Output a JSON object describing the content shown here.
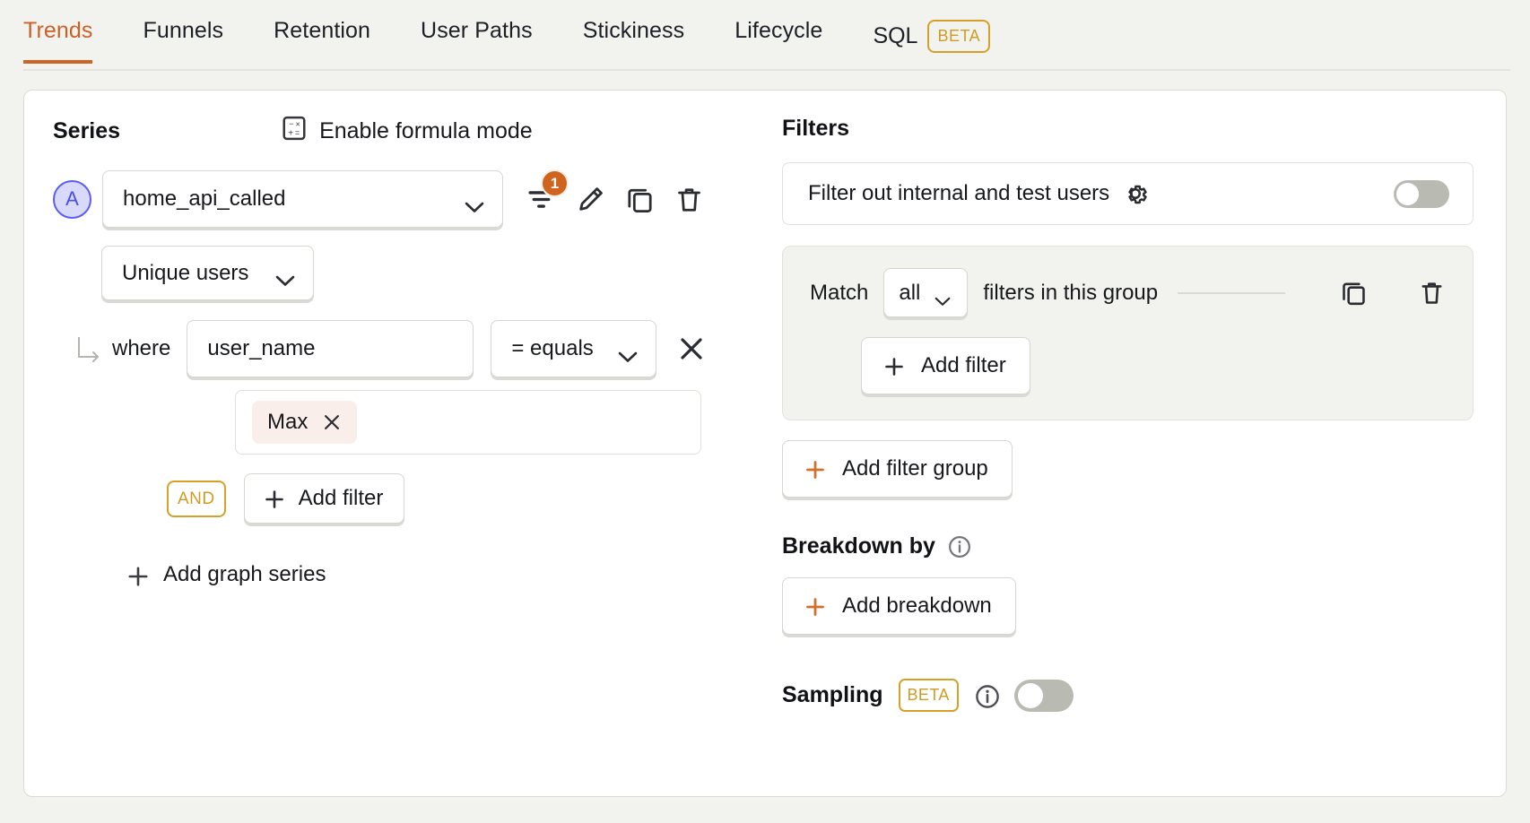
{
  "tabs": [
    {
      "label": "Trends",
      "active": true
    },
    {
      "label": "Funnels",
      "active": false
    },
    {
      "label": "Retention",
      "active": false
    },
    {
      "label": "User Paths",
      "active": false
    },
    {
      "label": "Stickiness",
      "active": false
    },
    {
      "label": "Lifecycle",
      "active": false
    }
  ],
  "sql_tab": {
    "label": "SQL",
    "badge": "BETA"
  },
  "series": {
    "title": "Series",
    "formula_label": "Enable formula mode",
    "formula_icon": "calculator-icon",
    "letter": "A",
    "event": "home_api_called",
    "filter_count": "1",
    "math": "Unique users",
    "where_label": "where",
    "property": "user_name",
    "operator": "= equals",
    "value_tag": "Max",
    "and_label": "AND",
    "add_filter_label": "Add filter",
    "add_series_label": "Add graph series"
  },
  "filters": {
    "title": "Filters",
    "internal_users_label": "Filter out internal and test users",
    "internal_users_toggle": "off",
    "group": {
      "match_prefix": "Match",
      "match_value": "all",
      "match_suffix": "filters in this group",
      "add_filter_label": "Add filter"
    },
    "add_filter_group_label": "Add filter group"
  },
  "breakdown": {
    "title": "Breakdown by",
    "add_breakdown_label": "Add breakdown"
  },
  "sampling": {
    "label": "Sampling",
    "badge": "BETA",
    "toggle": "off"
  },
  "colors": {
    "accent": "#cc6425",
    "beta": "#cf9b25",
    "series_letter": "#4a4df0",
    "page_bg": "#f2f3ee",
    "tag_bg": "#faeeea"
  }
}
